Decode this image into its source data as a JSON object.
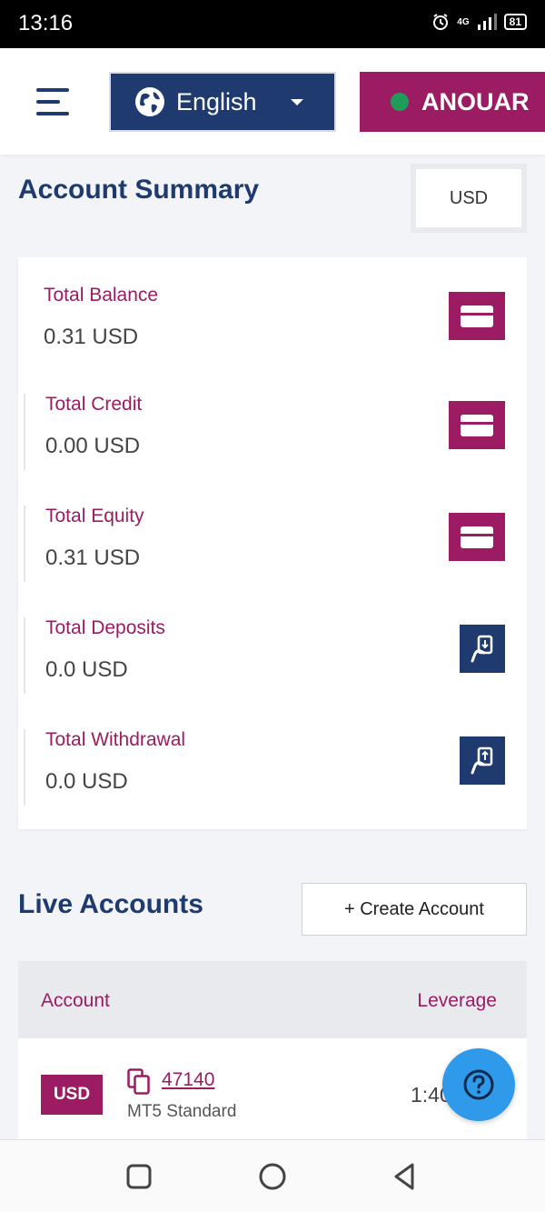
{
  "status_bar": {
    "time": "13:16",
    "network": "4G",
    "battery": "81"
  },
  "header": {
    "language": "English",
    "user": "ANOUAR"
  },
  "summary": {
    "title": "Account Summary",
    "currency": "USD",
    "metrics": [
      {
        "label": "Total Balance",
        "value": "0.31 USD",
        "icon": "credit-card-icon"
      },
      {
        "label": "Total Credit",
        "value": "0.00 USD",
        "icon": "credit-card-icon"
      },
      {
        "label": "Total Equity",
        "value": "0.31 USD",
        "icon": "credit-card-icon"
      },
      {
        "label": "Total Deposits",
        "value": "0.0 USD",
        "icon": "deposit-icon"
      },
      {
        "label": "Total Withdrawal",
        "value": "0.0 USD",
        "icon": "withdrawal-icon"
      }
    ]
  },
  "live_accounts": {
    "title": "Live Accounts",
    "create_label": "+ Create Account",
    "columns": {
      "account": "Account",
      "leverage": "Leverage"
    },
    "rows": [
      {
        "currency": "USD",
        "number": "47140",
        "type": "MT5 Standard",
        "leverage": "1:40"
      }
    ]
  },
  "colors": {
    "primary_navy": "#1e3a6e",
    "accent_magenta": "#9b1c62",
    "help_blue": "#2f9ae9",
    "online_green": "#1f9c5a"
  }
}
